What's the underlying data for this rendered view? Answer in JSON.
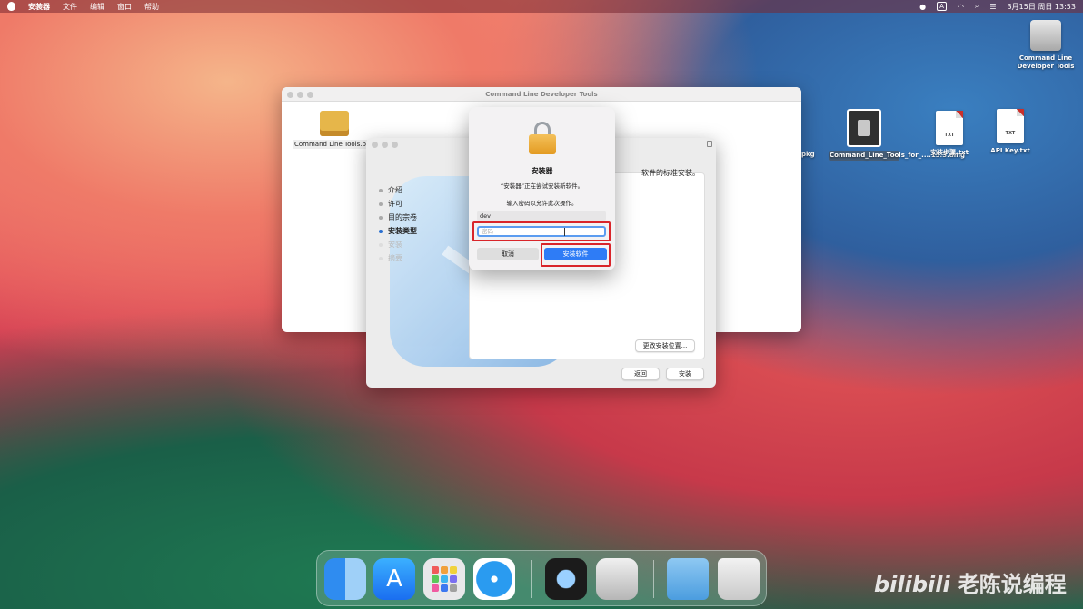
{
  "menubar": {
    "app_name": "安装器",
    "items": [
      "文件",
      "编辑",
      "窗口",
      "帮助"
    ],
    "input_indicator": "A",
    "datetime": "3月15日 周日 13:53"
  },
  "desktop_icons": [
    {
      "label": "Command Line Developer Tools",
      "icon": "drive-icon"
    },
    {
      "label": ".pkg",
      "icon": "pkg-icon"
    },
    {
      "label": "Command_Line_Tools_for_....15.3.dmg",
      "icon": "dmg-icon"
    },
    {
      "label": "安装步骤.txt",
      "icon": "text-file-icon",
      "tag": "TXT"
    },
    {
      "label": "API Key.txt",
      "icon": "text-file-icon",
      "tag": "TXT"
    }
  ],
  "finder_window": {
    "title": "Command Line Developer Tools",
    "pkg_label": "Command Line Tools.p"
  },
  "installer_window": {
    "steps": [
      {
        "label": "介绍",
        "state": "done"
      },
      {
        "label": "许可",
        "state": "done"
      },
      {
        "label": "目的宗卷",
        "state": "done"
      },
      {
        "label": "安装类型",
        "state": "active"
      },
      {
        "label": "安装",
        "state": "pending"
      },
      {
        "label": "摘要",
        "state": "pending"
      }
    ],
    "panel_text": "软件的标准安装。",
    "change_location_button": "更改安装位置...",
    "back_button": "返回",
    "install_button": "安装"
  },
  "auth_dialog": {
    "title": "安装器",
    "message": "“安装器”正在尝试安装新软件。",
    "prompt": "输入密码以允许此次操作。",
    "username": "dev",
    "password_placeholder": "密码",
    "cancel_button": "取消",
    "confirm_button": "安装软件"
  },
  "watermark": {
    "brand": "bilibili",
    "channel": "老陈说编程"
  },
  "colors": {
    "accent": "#2e7cf6",
    "highlight_box": "#d9252a"
  }
}
